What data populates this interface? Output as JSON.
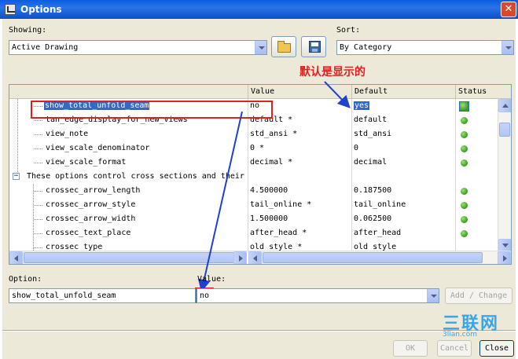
{
  "window": {
    "title": "Options",
    "close_label": "✕"
  },
  "showing": {
    "label": "Showing:",
    "value": "Active Drawing"
  },
  "sort": {
    "label": "Sort:",
    "value": "By Category"
  },
  "table": {
    "headers": {
      "value": "Value",
      "default": "Default",
      "status": "Status"
    },
    "rows": [
      {
        "name": "show_total_unfold_seam",
        "value": "no",
        "default": "yes"
      },
      {
        "name": "tan_edge_display_for_new_views",
        "value": "default *",
        "default": "default"
      },
      {
        "name": "view_note",
        "value": "std_ansi *",
        "default": "std_ansi"
      },
      {
        "name": "view_scale_denominator",
        "value": "0 *",
        "default": "0"
      },
      {
        "name": "view_scale_format",
        "value": "decimal *",
        "default": "decimal"
      },
      {
        "name": "These options control cross sections and their",
        "value": "",
        "default": ""
      },
      {
        "name": "crossec_arrow_length",
        "value": "4.500000",
        "default": "0.187500"
      },
      {
        "name": "crossec_arrow_style",
        "value": "tail_online *",
        "default": "tail_online"
      },
      {
        "name": "crossec_arrow_width",
        "value": "1.500000",
        "default": "0.062500"
      },
      {
        "name": "crossec_text_place",
        "value": "after_head *",
        "default": "after_head"
      },
      {
        "name": "crossec_type",
        "value": "old_style *",
        "default": "old_style"
      }
    ]
  },
  "annotation": {
    "text": "默认是显示的"
  },
  "option": {
    "label": "Option:",
    "value": "show_total_unfold_seam"
  },
  "value_field": {
    "label": "Value:",
    "value": "no"
  },
  "buttons": {
    "add_change": "Add / Change",
    "ok": "OK",
    "cancel": "Cancel",
    "close": "Close"
  },
  "watermark": {
    "text": "三联网",
    "subtext": "3lian.com"
  },
  "colors": {
    "annotation": "#e02020",
    "arrow": "#2040d0",
    "status_ok": "#3a9a1e"
  }
}
